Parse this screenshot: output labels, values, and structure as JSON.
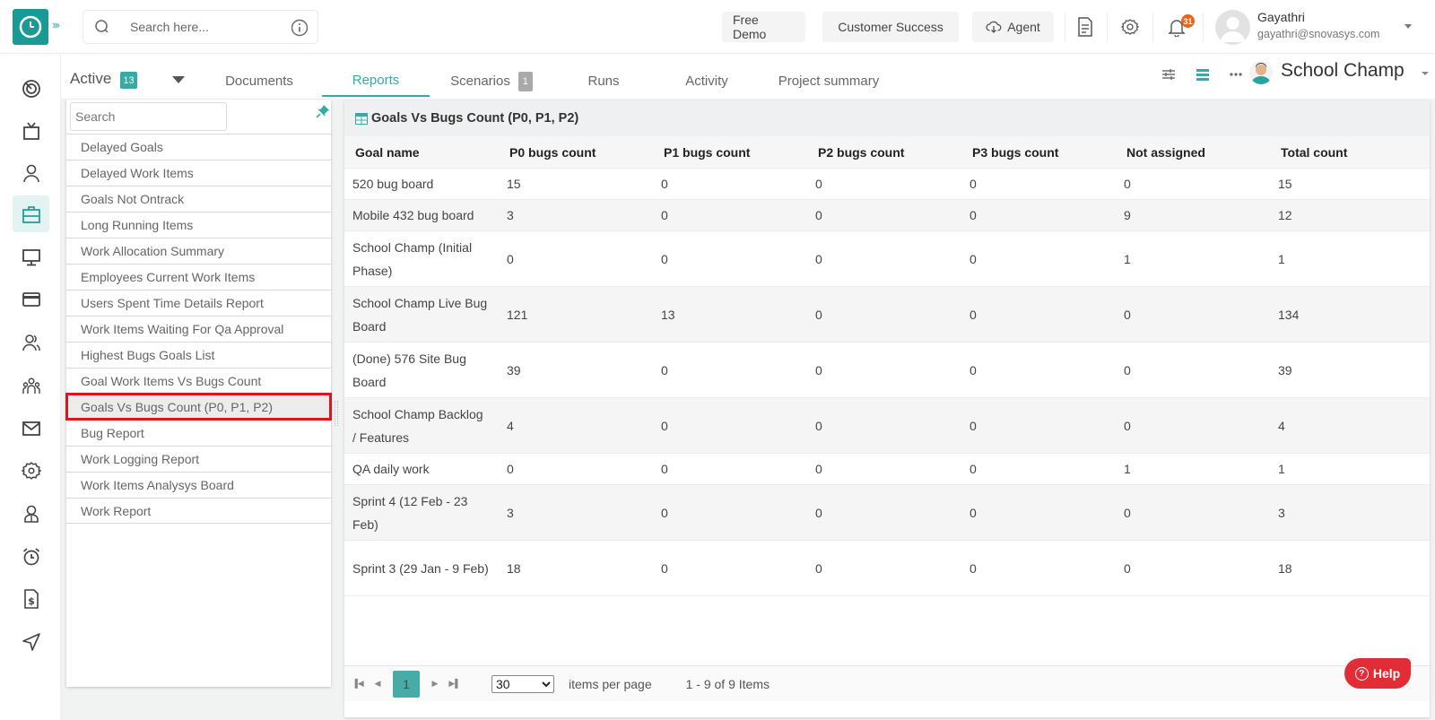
{
  "header": {
    "search_placeholder": "Search here...",
    "buttons": {
      "free_demo": "Free Demo",
      "customer_success": "Customer Success",
      "agent": "Agent"
    },
    "notification_count": "31",
    "user": {
      "name": "Gayathri",
      "email": "gayathri@snovasys.com"
    }
  },
  "rail": {
    "items": [
      {
        "icon": "dashboard-icon"
      },
      {
        "icon": "tv-icon"
      },
      {
        "icon": "user-icon"
      },
      {
        "icon": "briefcase-icon",
        "active": true
      },
      {
        "icon": "monitor-icon"
      },
      {
        "icon": "card-icon"
      },
      {
        "icon": "users-icon"
      },
      {
        "icon": "team-icon"
      },
      {
        "icon": "mail-icon"
      },
      {
        "icon": "settings-icon"
      },
      {
        "icon": "profile-icon"
      },
      {
        "icon": "alarm-icon"
      },
      {
        "icon": "invoice-icon"
      },
      {
        "icon": "send-icon"
      }
    ]
  },
  "tabbar": {
    "status_label": "Active",
    "status_count": "13",
    "tabs": [
      {
        "label": "Documents"
      },
      {
        "label": "Reports",
        "active": true
      },
      {
        "label": "Scenarios",
        "count": "1"
      },
      {
        "label": "Runs"
      },
      {
        "label": "Activity"
      },
      {
        "label": "Project summary"
      }
    ],
    "project_name": "School Champ"
  },
  "report_list": {
    "search_placeholder": "Search",
    "items": [
      "Delayed Goals",
      "Delayed Work Items",
      "Goals Not Ontrack",
      "Long Running Items",
      "Work Allocation Summary",
      "Employees Current Work Items",
      "Users Spent Time Details Report",
      "Work Items Waiting For Qa Approval",
      "Highest Bugs Goals List",
      "Goal Work Items Vs Bugs Count",
      "Goals Vs Bugs Count (P0, P1, P2)",
      "Bug Report",
      "Work Logging Report",
      "Work Items Analysys Board",
      "Work Report"
    ],
    "selected_index": 10
  },
  "grid": {
    "title": "Goals Vs Bugs Count (P0, P1, P2)",
    "columns": [
      "Goal name",
      "P0 bugs count",
      "P1 bugs count",
      "P2 bugs count",
      "P3 bugs count",
      "Not assigned",
      "Total count"
    ],
    "rows": [
      [
        "520 bug board",
        "15",
        "0",
        "0",
        "0",
        "0",
        "15"
      ],
      [
        "Mobile 432 bug board",
        "3",
        "0",
        "0",
        "0",
        "9",
        "12"
      ],
      [
        "School Champ (Initial Phase)",
        "0",
        "0",
        "0",
        "0",
        "1",
        "1"
      ],
      [
        "School Champ Live Bug Board",
        "121",
        "13",
        "0",
        "0",
        "0",
        "134"
      ],
      [
        "(Done) 576 Site Bug Board",
        "39",
        "0",
        "0",
        "0",
        "0",
        "39"
      ],
      [
        "School Champ Backlog / Features",
        "4",
        "0",
        "0",
        "0",
        "0",
        "4"
      ],
      [
        "QA daily work",
        "0",
        "0",
        "0",
        "0",
        "1",
        "1"
      ],
      [
        "Sprint 4 (12 Feb - 23 Feb)",
        "3",
        "0",
        "0",
        "0",
        "0",
        "3"
      ],
      [
        "Sprint 3 (29 Jan - 9 Feb)",
        "18",
        "0",
        "0",
        "0",
        "0",
        "18"
      ]
    ],
    "pager": {
      "current_page": "1",
      "page_size": "30",
      "page_size_label": "items per page",
      "info": "1 - 9 of 9 Items"
    }
  },
  "help_label": "Help",
  "colors": {
    "accent": "#35aba6",
    "selection_outline": "#e0141b",
    "help": "#e22d36",
    "notification": "#e8651a"
  }
}
